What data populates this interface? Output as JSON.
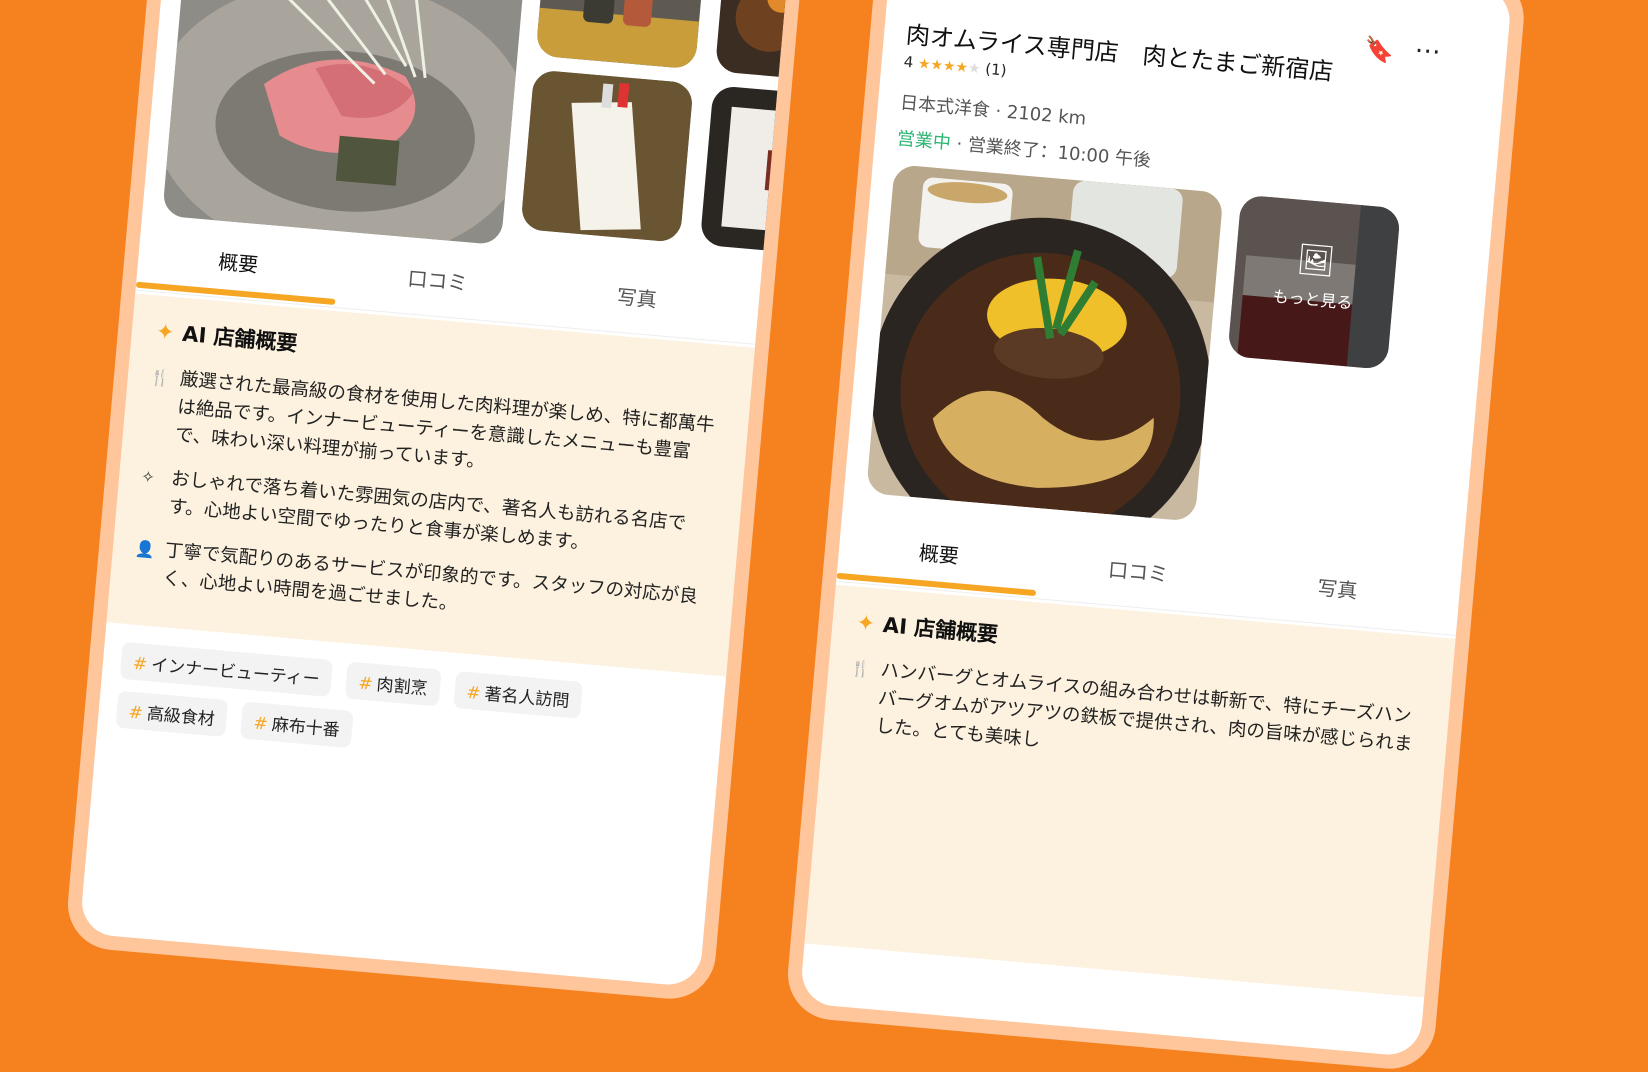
{
  "left_phone": {
    "tabs": [
      {
        "label": "概要",
        "active": true
      },
      {
        "label": "口コミ",
        "active": false
      },
      {
        "label": "写真",
        "active": false
      }
    ],
    "summary": {
      "title": "AI 店舗概要",
      "items": [
        {
          "icon": "cutlery-icon",
          "text": "厳選された最高級の食材を使用した肉料理が楽しめ、特に都萬牛は絶品です。インナービューティーを意識したメニューも豊富で、味わい深い料理が揃っています。"
        },
        {
          "icon": "sparkle-outline-icon",
          "text": "おしゃれで落ち着いた雰囲気の店内で、著名人も訪れる名店です。心地よい空間でゆったりと食事が楽しめます。"
        },
        {
          "icon": "person-icon",
          "text": "丁寧で気配りのあるサービスが印象的です。スタッフの対応が良く、心地よい時間を過ごせました。"
        }
      ]
    },
    "tags": [
      "インナービューティー",
      "肉割烹",
      "著名人訪問",
      "高級食材",
      "麻布十番"
    ]
  },
  "right_phone": {
    "store_name": "肉オムライス専門店　肉とたまご新宿店",
    "rating_value": "4",
    "rating_stars": 4,
    "rating_count": "(1)",
    "category_distance": "日本式洋食 · 2102 km",
    "status_open": "営業中",
    "status_hours": " · 営業終了：10:00 午後",
    "more_photos_label": "もっと見る",
    "tabs": [
      {
        "label": "概要",
        "active": true
      },
      {
        "label": "口コミ",
        "active": false
      },
      {
        "label": "写真",
        "active": false
      }
    ],
    "summary": {
      "title": "AI 店舗概要",
      "items": [
        {
          "icon": "cutlery-icon",
          "text": "ハンバーグとオムライスの組み合わせは斬新で、特にチーズハンバーグオムがアツアツの鉄板で提供され、肉の旨味が感じられました。とても美味し"
        }
      ]
    }
  },
  "colors": {
    "background": "#f5821f",
    "accent": "#f6a623",
    "open_green": "#2bb673",
    "summary_bg": "#fdf2df"
  }
}
